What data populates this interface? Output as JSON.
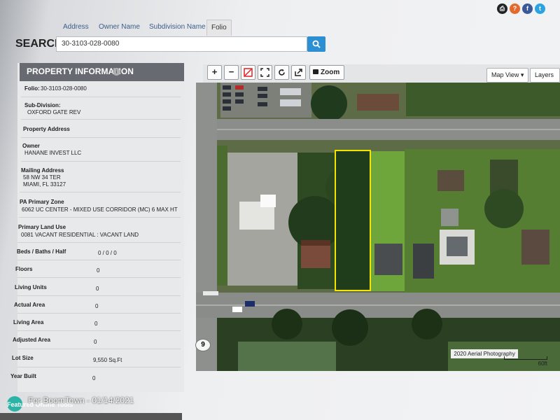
{
  "tabs": [
    {
      "label": "Address"
    },
    {
      "label": "Owner Name"
    },
    {
      "label": "Subdivision Name"
    },
    {
      "label": "Folio"
    }
  ],
  "search": {
    "label": "SEARCH:",
    "value": "30-3103-028-0080"
  },
  "panel": {
    "title": "PROPERTY INFORMATION"
  },
  "property": {
    "folio_label": "Folio:",
    "folio": "30-3103-028-0080",
    "subdivision_label": "Sub-Division:",
    "subdivision": "OXFORD GATE REV",
    "address_label": "Property Address",
    "owner_label": "Owner",
    "owner": "HANANE INVEST LLC",
    "mailing_label": "Mailing Address",
    "mailing_line1": "58 NW 34 TER",
    "mailing_line2": "MIAMI, FL 33127",
    "zone_label": "PA Primary Zone",
    "zone": "6062 UC CENTER - MIXED USE CORRIDOR (MC) 6 MAX HT",
    "landuse_label": "Primary Land Use",
    "landuse": "0081 VACANT RESIDENTIAL : VACANT LAND",
    "beds_label": "Beds / Baths / Half",
    "beds": "0 / 0 / 0",
    "floors_label": "Floors",
    "floors": "0",
    "units_label": "Living Units",
    "units": "0",
    "actual_area_label": "Actual Area",
    "actual_area": "0",
    "living_area_label": "Living Area",
    "living_area": "0",
    "adjusted_area_label": "Adjusted Area",
    "adjusted_area": "0",
    "lot_size_label": "Lot Size",
    "lot_size": "9,550 Sq.Ft",
    "year_built_label": "Year Built",
    "year_built": "0"
  },
  "map": {
    "zoom_label": "Zoom",
    "map_view_label": "Map View ▾",
    "layers_label": "Layers ▾",
    "caption": "2020 Aerial Photography",
    "scale": "60ft",
    "route_number": "9"
  },
  "watermark": "For BoomTown - 01/14/2021",
  "featured": "Featured Online Tools",
  "colors": {
    "accent": "#2c8fd3",
    "panel_header": "#676a70",
    "parcel_outline": "#f4e400"
  }
}
